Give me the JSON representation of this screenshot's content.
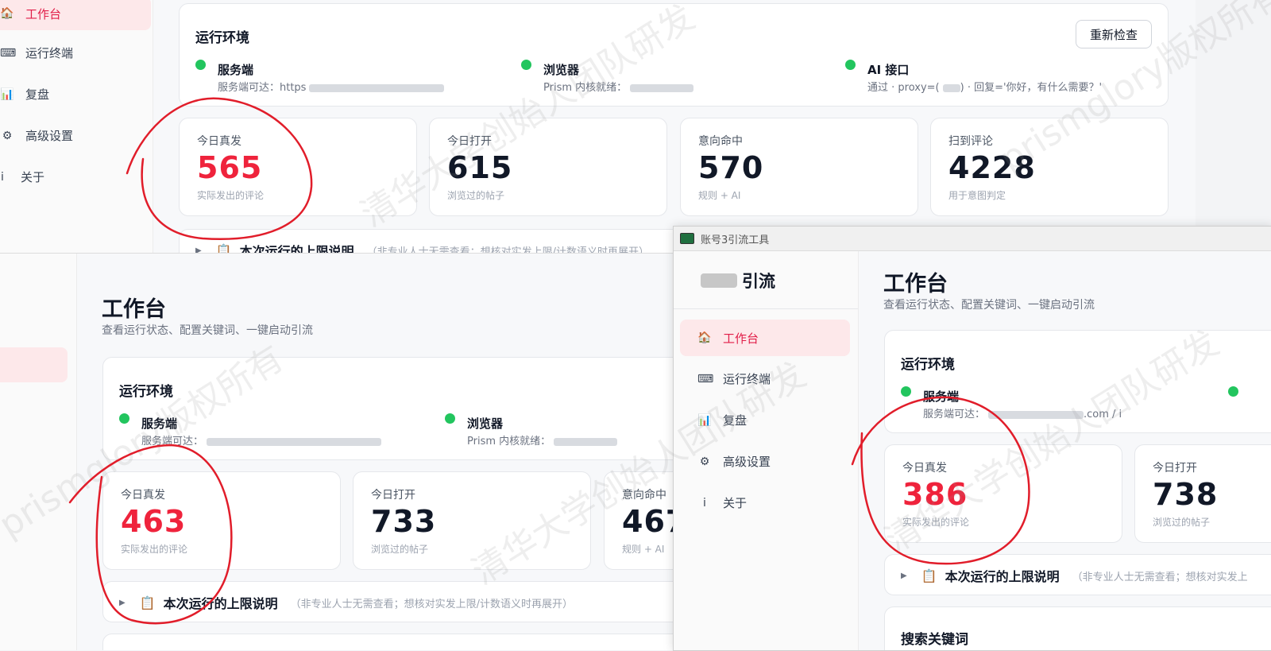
{
  "sidebar_items": [
    {
      "label": "工作台",
      "icon": "home-icon",
      "glyph": "🏠"
    },
    {
      "label": "运行终端",
      "icon": "terminal-icon",
      "glyph": "⌨"
    },
    {
      "label": "复盘",
      "icon": "chart-icon",
      "glyph": "📊"
    },
    {
      "label": "高级设置",
      "icon": "gear-icon",
      "glyph": "⚙"
    },
    {
      "label": "关于",
      "icon": "info-icon",
      "glyph": "i"
    }
  ],
  "page": {
    "title": "工作台",
    "subtitle": "查看运行状态、配置关键词、一键启动引流"
  },
  "env": {
    "title": "运行环境",
    "recheck": "重新检查",
    "server_label": "服务端",
    "server_sub": "服务端可达：",
    "server_sub_prefix": "服务端可达：https",
    "browser_label": "浏览器",
    "browser_sub": "Prism 内核就绪：",
    "ai_label": "AI 接口",
    "ai_sub_a": "通过 · proxy=(",
    "ai_sub_b": ") · 回复='你好，有什么需要？'"
  },
  "stat_labels": {
    "sent": "今日真发",
    "sent_sub": "实际发出的评论",
    "opened": "今日打开",
    "opened_sub": "浏览过的帖子",
    "hit": "意向命中",
    "hit_sub": "规则 + AI",
    "scanned": "扫到评论",
    "scanned_sub": "用于意图判定"
  },
  "win1": {
    "sent": "565",
    "opened": "615",
    "hit": "570",
    "scanned": "4228"
  },
  "win2": {
    "sent": "463",
    "opened": "733",
    "hit": "467"
  },
  "win3": {
    "window_title": "账号3引流工具",
    "logo_text": "引流",
    "sent": "386",
    "opened": "738",
    "server_sub_suffix": ".com / i",
    "search_title": "搜索关键词"
  },
  "limit": {
    "title": "本次运行的上限说明",
    "hint": "（非专业人士无需查看；想核对实发上限/计数语义时再展开）",
    "hint_short": "（非专业人士无需查看；想核对实发上"
  },
  "watermarks": [
    "清华大学创始人团队研发",
    "prismglory版权所有"
  ]
}
